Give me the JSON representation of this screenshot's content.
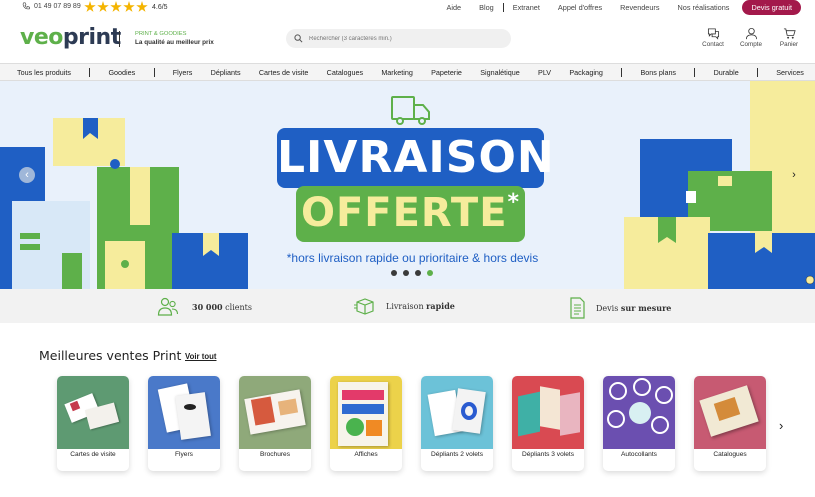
{
  "topbar": {
    "phone": "01 49 07 89 89",
    "rating": "4.6/5",
    "links": [
      "Aide",
      "Blog",
      "Extranet",
      "Appel d'offres",
      "Revendeurs",
      "Nos réalisations"
    ],
    "cta": "Devis gratuit"
  },
  "header": {
    "logo_part1": "veo",
    "logo_part2": "print",
    "tagline_top": "PRINT & GOODIES",
    "tagline_bottom": "La qualité au meilleur prix",
    "search_placeholder": "Rechercher (3 caractères min.)",
    "icons": [
      {
        "label": "Contact",
        "icon": "chat-icon"
      },
      {
        "label": "Compte",
        "icon": "user-icon"
      },
      {
        "label": "Panier",
        "icon": "cart-icon"
      }
    ]
  },
  "nav": [
    "Tous les produits",
    "Goodies",
    "Flyers",
    "Dépliants",
    "Cartes de visite",
    "Catalogues",
    "Marketing",
    "Papeterie",
    "Signalétique",
    "PLV",
    "Packaging",
    "Bons plans",
    "Durable",
    "Services"
  ],
  "hero": {
    "line1": "LIVRAISON",
    "line2": "OFFERTE",
    "asterisk": "*",
    "footnote": "*hors livraison rapide ou prioritaire & hors devis",
    "slides": 4,
    "active_slide": 4
  },
  "features": [
    {
      "strong": "30 000",
      "text": " clients",
      "icon": "people-icon"
    },
    {
      "text": "Livraison ",
      "strong": "rapide",
      "icon": "delivery-box-icon"
    },
    {
      "text": "Devis ",
      "strong": "sur mesure",
      "icon": "document-icon"
    }
  ],
  "best": {
    "title": "Meilleures ventes Print",
    "link": "Voir tout",
    "products": [
      "Cartes de visite",
      "Flyers",
      "Brochures",
      "Affiches",
      "Dépliants 2 volets",
      "Dépliants 3 volets",
      "Autocollants",
      "Catalogues"
    ]
  },
  "colors": {
    "green": "#5eb04a",
    "navy": "#2d3b54",
    "burgundy": "#a3194b",
    "blue": "#1f5fc4"
  }
}
